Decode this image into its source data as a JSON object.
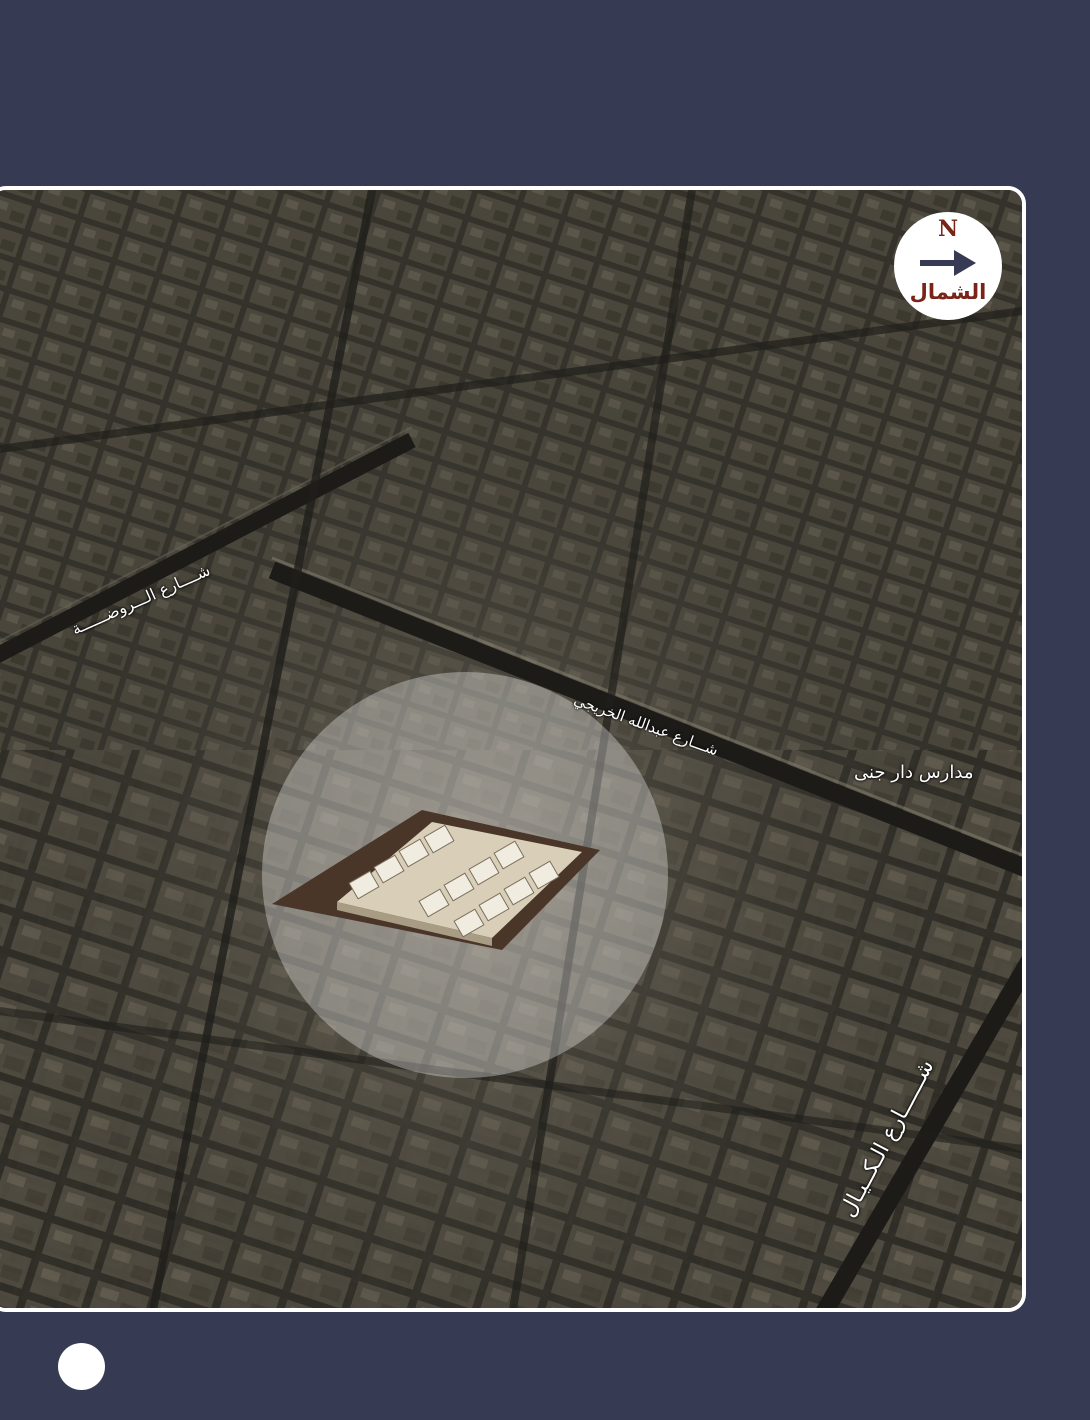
{
  "compass": {
    "letter": "N",
    "label": "الشمال",
    "icon": "arrow-right-icon",
    "arrow_color": "#363a52",
    "text_color": "#7a2418"
  },
  "streets": {
    "rawda": "شــــارع الـــروضــــــة",
    "khuraiji": "شـــارع عبدالله الخريجي",
    "kayyal": "شــــــارع الـكــيـال"
  },
  "poi": {
    "school": "مدارس دار جنى"
  },
  "colors": {
    "page_background": "#363a52",
    "frame_border": "#ffffff",
    "highlight_circle": "#ffffff"
  }
}
